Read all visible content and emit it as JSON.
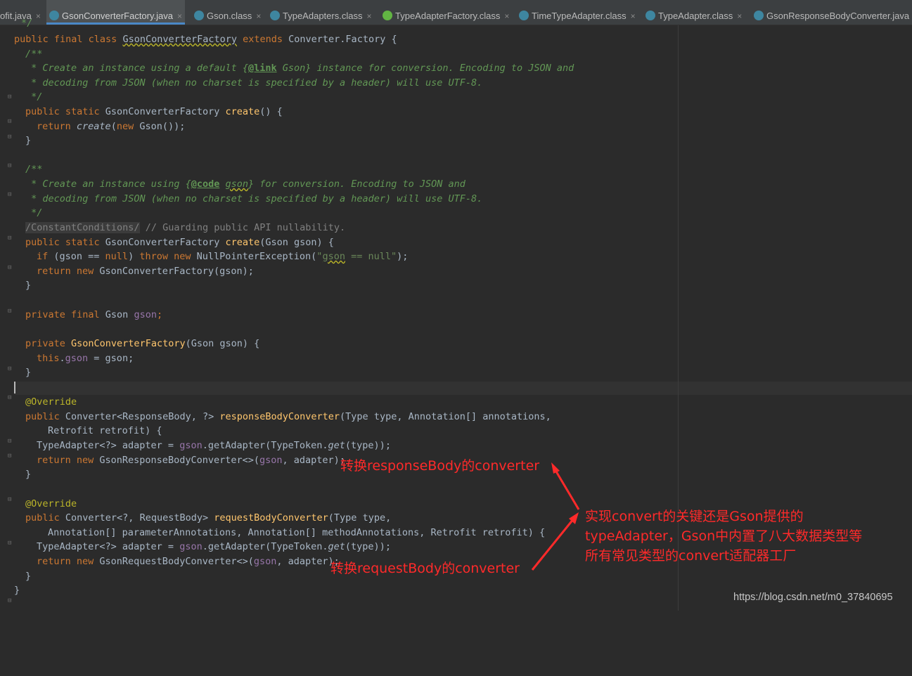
{
  "tabs": [
    {
      "label": "ofit.java",
      "icon": "java-file-icon",
      "active": false
    },
    {
      "label": "GsonConverterFactory.java",
      "icon": "java-class-icon",
      "active": true
    },
    {
      "label": "Gson.class",
      "icon": "class-file-icon",
      "active": false
    },
    {
      "label": "TypeAdapters.class",
      "icon": "class-file-icon",
      "active": false
    },
    {
      "label": "TypeAdapterFactory.class",
      "icon": "interface-file-icon",
      "active": false
    },
    {
      "label": "TimeTypeAdapter.class",
      "icon": "class-file-icon",
      "active": false
    },
    {
      "label": "TypeAdapter.class",
      "icon": "class-file-icon",
      "active": false
    },
    {
      "label": "GsonResponseBodyConverter.java",
      "icon": "class-file-icon",
      "active": false
    }
  ],
  "tab_close_glyph": "×",
  "code": {
    "l0": "*/",
    "l1": [
      "public final class ",
      "GsonConverterFactory",
      " extends ",
      "Converter.Factory {"
    ],
    "l2": "/**",
    "l3": [
      " * Create an instance using a default {",
      "@link",
      " Gson} instance for conversion. Encoding to JSON and"
    ],
    "l4": " * decoding from JSON (when no charset is specified by a header) will use UTF-8.",
    "l5": " */",
    "l6": [
      "public static ",
      "GsonConverterFactory ",
      "create",
      "() {"
    ],
    "l7": [
      "return ",
      "create",
      "(",
      "new ",
      "Gson());"
    ],
    "l8": "}",
    "l9": "/**",
    "l10": [
      " * Create an instance using {",
      "@code",
      " ",
      "gson",
      "} for conversion. Encoding to JSON and"
    ],
    "l11": " * decoding from JSON (when no charset is specified by a header) will use UTF-8.",
    "l12": " */",
    "l13": [
      "/ConstantConditions/",
      " // Guarding public API nullability."
    ],
    "l14": [
      "public static ",
      "GsonConverterFactory ",
      "create",
      "(Gson gson) {"
    ],
    "l15": [
      "if ",
      "(gson == ",
      "null",
      ") ",
      "throw new ",
      "NullPointerException(",
      "\"",
      "gson",
      " == null\"",
      ");"
    ],
    "l16": [
      "return new ",
      "GsonConverterFactory(gson);"
    ],
    "l17": "}",
    "l18": [
      "private final ",
      "Gson ",
      "gson",
      ";"
    ],
    "l19": [
      "private ",
      "GsonConverterFactory",
      "(Gson gson) {"
    ],
    "l20": [
      "this",
      ".",
      "gson",
      " = gson;"
    ],
    "l21": "}",
    "l22": "@Override",
    "l23": [
      "public ",
      "Converter<ResponseBody, ?> ",
      "responseBodyConverter",
      "(Type type, Annotation[] annotations,"
    ],
    "l24": "Retrofit retrofit) {",
    "l25": [
      "TypeAdapter<?> adapter = ",
      "gson",
      ".getAdapter(TypeToken.",
      "get",
      "(type));"
    ],
    "l26": [
      "return new ",
      "GsonResponseBodyConverter<>(",
      "gson",
      ", adapter);"
    ],
    "l27": "}",
    "l28": "@Override",
    "l29": [
      "public ",
      "Converter<?, RequestBody> ",
      "requestBodyConverter",
      "(Type type,"
    ],
    "l30": "Annotation[] parameterAnnotations, Annotation[] methodAnnotations, Retrofit retrofit) {",
    "l31": [
      "TypeAdapter<?> adapter = ",
      "gson",
      ".getAdapter(TypeToken.",
      "get",
      "(type));"
    ],
    "l32": [
      "return new ",
      "GsonRequestBodyConverter<>(",
      "gson",
      ", adapter);"
    ],
    "l33": "}",
    "l34": "}"
  },
  "annotations": {
    "response": "转换responseBody的converter",
    "request": "转换requestBody的converter",
    "note_line1": "实现convert的关键还是Gson提供的",
    "note_line2": "typeAdapter，Gson中内置了八大数据类型等",
    "note_line3": "所有常见类型的convert适配器工厂",
    "color": "#ff2a2a"
  },
  "watermark": "https://blog.csdn.net/m0_37840695"
}
